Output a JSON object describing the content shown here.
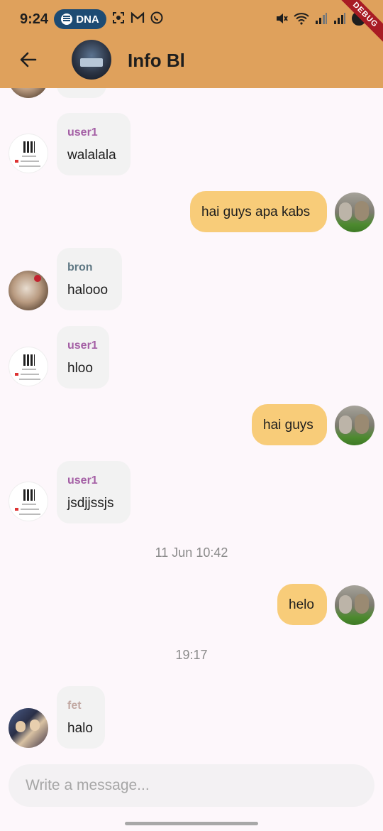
{
  "status_bar": {
    "time": "9:24",
    "pill_label": "DNA",
    "left_icons": [
      "screenshot-icon",
      "gmail-icon",
      "whatsapp-icon"
    ],
    "right_icons": [
      "mute-icon",
      "wifi-icon",
      "signal-icon",
      "signal-icon",
      "battery-icon"
    ],
    "debug_banner": "DEBUG"
  },
  "header": {
    "title": "Info Bl",
    "back_icon": "arrow-left-icon"
  },
  "colors": {
    "app_bar": "#dfa15c",
    "outgoing_bubble": "#f8cc79",
    "incoming_bubble": "#f2f2f2",
    "background": "#fdf7fb",
    "sender_user1": "#a45fa5",
    "sender_bron": "#5f7884",
    "sender_fet": "#c2a9a3"
  },
  "messages": [
    {
      "direction": "in",
      "sender": "user1",
      "text": "walalala"
    },
    {
      "direction": "out",
      "text": "hai guys apa kabs"
    },
    {
      "direction": "in",
      "sender": "bron",
      "text": "halooo"
    },
    {
      "direction": "in",
      "sender": "user1",
      "text": "hloo"
    },
    {
      "direction": "out",
      "text": "hai guys"
    },
    {
      "direction": "in",
      "sender": "user1",
      "text": "jsdjjssjs"
    },
    {
      "direction": "out",
      "text": "helo"
    },
    {
      "direction": "in",
      "sender": "fet",
      "text": "halo"
    }
  ],
  "timestamps": [
    "11 Jun 10:42",
    "19:17"
  ],
  "composer": {
    "placeholder": "Write a message..."
  }
}
